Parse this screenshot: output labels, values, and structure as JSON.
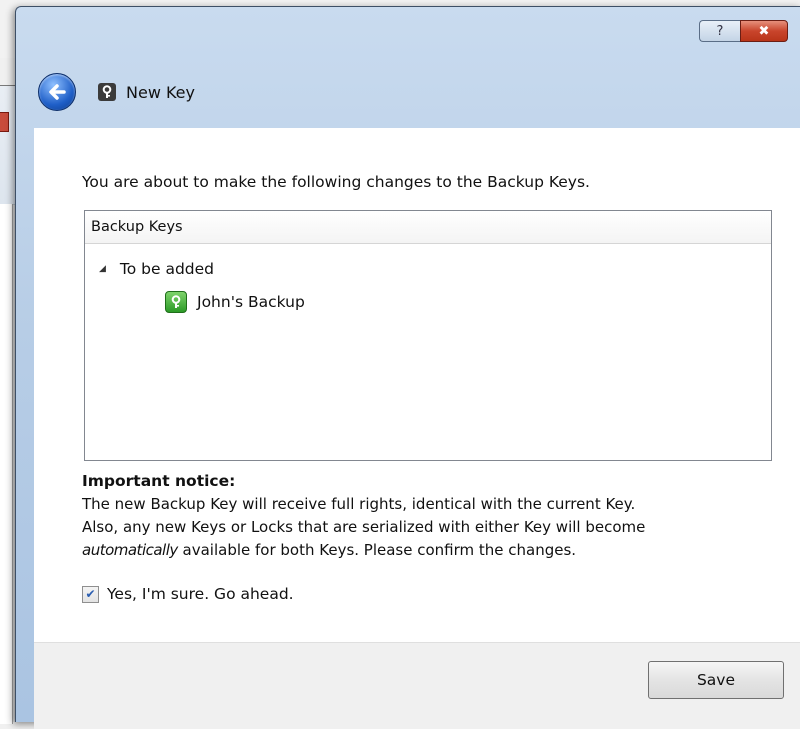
{
  "dialog": {
    "title": "New Key",
    "help_button_label": "?",
    "close_button_label": "✖"
  },
  "content": {
    "intro": "You are about to make the following changes to the Backup Keys.",
    "tree": {
      "header": "Backup Keys",
      "group_label": "To be added",
      "items": [
        "John's Backup"
      ]
    },
    "notice": {
      "title": "Important notice:",
      "line1": "The new Backup Key will receive full rights, identical with the current Key.",
      "line2": "Also, any new Keys or Locks that are serialized with either Key will become",
      "line3_emph": "automatically",
      "line3_rest": " available for both Keys. Please confirm the changes."
    },
    "confirm": {
      "label": "Yes, I'm sure. Go ahead.",
      "checked": true
    }
  },
  "footer": {
    "save_label": "Save"
  },
  "icons": {
    "back": "back-arrow-icon",
    "title_key": "key-icon",
    "item_key": "green-key-icon"
  },
  "colors": {
    "frame": "#b7cde6",
    "close": "#c9452c",
    "back_button": "#1f5fc8",
    "item_key": "#2c9a27"
  }
}
